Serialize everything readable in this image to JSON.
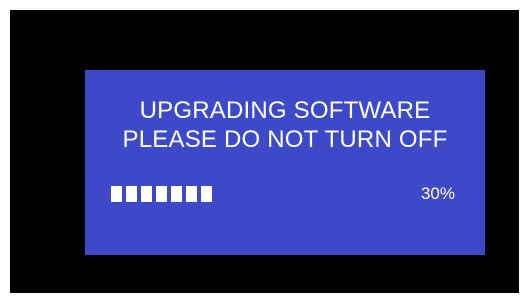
{
  "screen": {
    "title_line_1": "UPGRADING SOFTWARE",
    "title_line_2": "PLEASE DO NOT TURN OFF",
    "progress": {
      "percent_label": "30%",
      "value": 0.3,
      "visible_segments": 7
    }
  },
  "colors": {
    "frame_background": "#000000",
    "panel_background": "#3d49c9",
    "text": "#ffffff",
    "progress_segment": "#ffffff"
  }
}
